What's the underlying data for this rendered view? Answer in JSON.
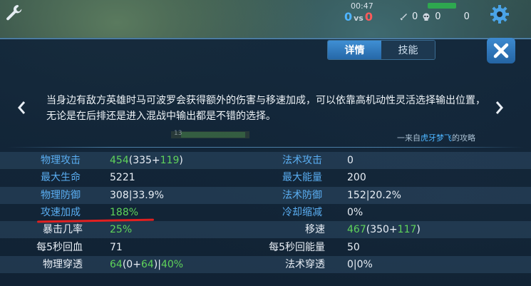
{
  "hud": {
    "time": "00:47",
    "score_blue": "0",
    "score_vs": "vs",
    "score_red": "0",
    "kills": "0",
    "deaths": "0",
    "assists": "0",
    "level_badge": "13"
  },
  "tabs": [
    {
      "label": "详情",
      "active": true
    },
    {
      "label": "技能",
      "active": false
    }
  ],
  "description": "当身边有敌方英雄时马可波罗会获得额外的伤害与移速加成，可以依靠高机动性灵活选择输出位置，无论是在后排还是进入混战中输出都是不错的选择。",
  "credit": {
    "prefix": "一来自",
    "author": "虎牙梦飞",
    "suffix": "的攻略"
  },
  "stats_left": [
    {
      "label": "物理攻击",
      "parts": [
        {
          "t": "454",
          "c": "green"
        },
        {
          "t": "(335+",
          "c": "white"
        },
        {
          "t": "119",
          "c": "green"
        },
        {
          "t": ")",
          "c": "white"
        }
      ]
    },
    {
      "label": "最大生命",
      "parts": [
        {
          "t": "5221",
          "c": "white"
        }
      ]
    },
    {
      "label": "物理防御",
      "parts": [
        {
          "t": "308|33.9%",
          "c": "white"
        }
      ]
    },
    {
      "label": "攻速加成",
      "parts": [
        {
          "t": "188%",
          "c": "green"
        }
      ]
    },
    {
      "label": "暴击几率",
      "parts": [
        {
          "t": "25%",
          "c": "green"
        }
      ]
    },
    {
      "label": "每5秒回血",
      "parts": [
        {
          "t": "71",
          "c": "white"
        }
      ]
    },
    {
      "label": "物理穿透",
      "parts": [
        {
          "t": "64",
          "c": "green"
        },
        {
          "t": "(0+",
          "c": "white"
        },
        {
          "t": "64",
          "c": "green"
        },
        {
          "t": ")|",
          "c": "white"
        },
        {
          "t": "40%",
          "c": "green"
        }
      ]
    }
  ],
  "stats_right": [
    {
      "label": "法术攻击",
      "parts": [
        {
          "t": "0",
          "c": "white"
        }
      ]
    },
    {
      "label": "最大能量",
      "parts": [
        {
          "t": "200",
          "c": "white"
        }
      ]
    },
    {
      "label": "法术防御",
      "parts": [
        {
          "t": "152|20.2%",
          "c": "white"
        }
      ]
    },
    {
      "label": "冷却缩减",
      "parts": [
        {
          "t": "0%",
          "c": "white"
        }
      ]
    },
    {
      "label": "移速",
      "parts": [
        {
          "t": "467",
          "c": "green"
        },
        {
          "t": "(350+",
          "c": "white"
        },
        {
          "t": "117",
          "c": "green"
        },
        {
          "t": ")",
          "c": "white"
        }
      ]
    },
    {
      "label": "每5秒回能量",
      "parts": [
        {
          "t": "50",
          "c": "white"
        }
      ]
    },
    {
      "label": "法术穿透",
      "parts": [
        {
          "t": "0|0%",
          "c": "white"
        }
      ]
    }
  ],
  "colors": {
    "label_blue": "#5aaef2",
    "value_green": "#5fd35a",
    "tab_active": "#2f7cc0",
    "highlight_underline": "#e12020"
  },
  "icons": [
    "wrench-icon",
    "gear-icon",
    "close-icon",
    "chevron-left-icon",
    "chevron-right-icon",
    "sword-icon",
    "skull-icon"
  ]
}
